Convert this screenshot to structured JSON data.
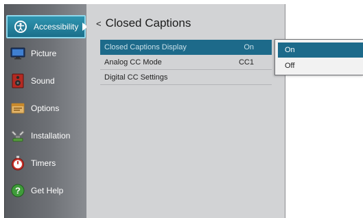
{
  "sidebar": {
    "items": [
      {
        "label": "Accessibility",
        "icon": "accessibility-icon",
        "active": true
      },
      {
        "label": "Picture",
        "icon": "picture-icon"
      },
      {
        "label": "Sound",
        "icon": "speaker-icon"
      },
      {
        "label": "Options",
        "icon": "options-icon"
      },
      {
        "label": "Installation",
        "icon": "installation-icon"
      },
      {
        "label": "Timers",
        "icon": "timer-icon"
      },
      {
        "label": "Get Help",
        "icon": "help-icon"
      }
    ]
  },
  "panel": {
    "back_symbol": "<",
    "title": "Closed Captions",
    "rows": [
      {
        "label": "Closed Captions Display",
        "value": "On",
        "selected": true
      },
      {
        "label": "Analog CC Mode",
        "value": "CC1"
      },
      {
        "label": "Digital CC Settings",
        "value": ""
      }
    ]
  },
  "popup": {
    "options": [
      {
        "label": "On",
        "selected": true
      },
      {
        "label": "Off"
      }
    ]
  },
  "colors": {
    "accent": "#1d6a8a",
    "active_menu": "#2f95b0",
    "panel_bg": "#d2d3d5"
  }
}
